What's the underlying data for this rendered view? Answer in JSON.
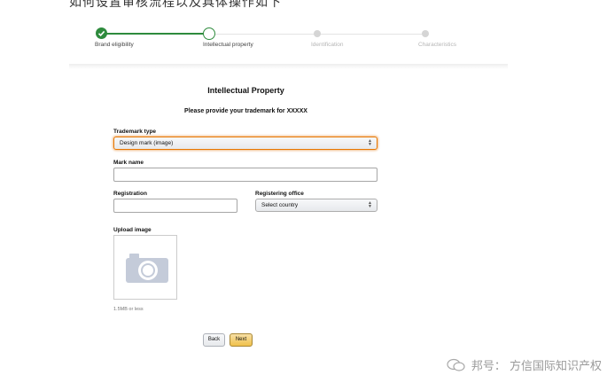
{
  "caption_top": "如何设置审核流程以及具体操作如下",
  "stepper": {
    "steps": [
      {
        "label": "Brand eligibility",
        "state": "done"
      },
      {
        "label": "Intellectual property",
        "state": "current"
      },
      {
        "label": "Identification",
        "state": "pending"
      },
      {
        "label": "Characteristics",
        "state": "pending"
      }
    ],
    "colors": {
      "done": "#2e8b3d",
      "pending": "#d5d5d5"
    }
  },
  "form": {
    "title": "Intellectual Property",
    "subtitle": "Please provide your trademark for XXXXX",
    "trademark_type": {
      "label": "Trademark type",
      "value": "Design mark (image)"
    },
    "mark_name": {
      "label": "Mark name",
      "value": ""
    },
    "registration": {
      "label": "Registration",
      "value": ""
    },
    "registering_office": {
      "label": "Registering office",
      "value": "Select country"
    },
    "upload": {
      "label": "Upload image",
      "hint": "1.5MB or less"
    }
  },
  "buttons": {
    "back": "Back",
    "next": "Next"
  },
  "watermark": {
    "text": "邦号：  方信国际知识产权"
  }
}
